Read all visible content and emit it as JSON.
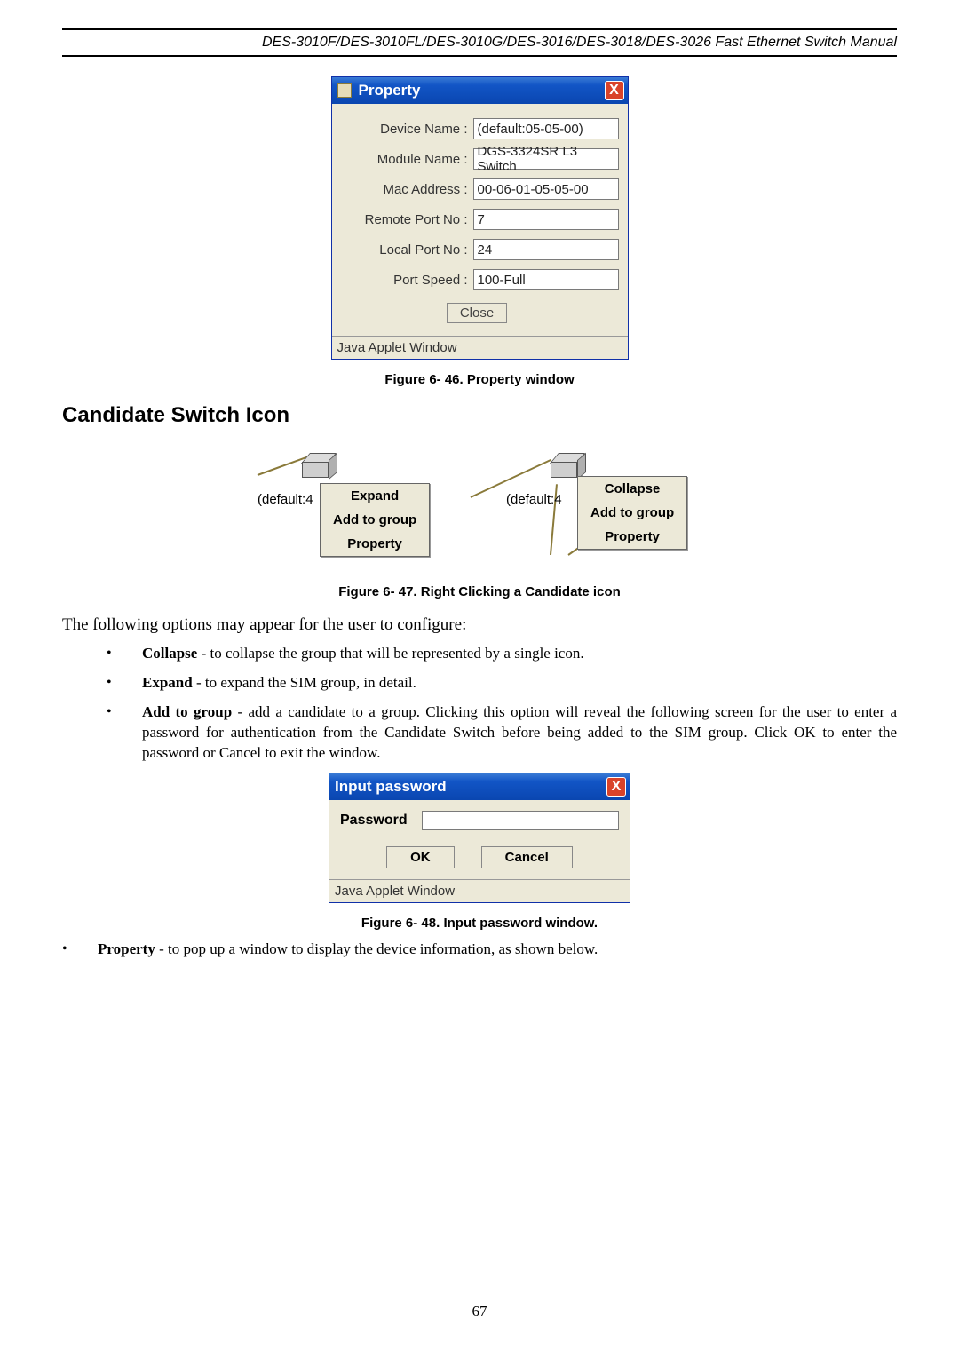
{
  "header": {
    "title": "DES-3010F/DES-3010FL/DES-3010G/DES-3016/DES-3018/DES-3026 Fast Ethernet Switch Manual"
  },
  "property_window": {
    "title": "Property",
    "close_x": "X",
    "rows": {
      "device_name_label": "Device Name :",
      "device_name_value": "(default:05-05-00)",
      "module_name_label": "Module Name :",
      "module_name_value": "DGS-3324SR L3 Switch",
      "mac_label": "Mac Address :",
      "mac_value": "00-06-01-05-05-00",
      "remote_port_label": "Remote Port No :",
      "remote_port_value": "7",
      "local_port_label": "Local Port No :",
      "local_port_value": "24",
      "port_speed_label": "Port Speed :",
      "port_speed_value": "100-Full"
    },
    "close_button": "Close",
    "status": "Java Applet Window"
  },
  "captions": {
    "fig46": "Figure 6- 46. Property window",
    "fig47": "Figure 6- 47. Right Clicking a Candidate icon",
    "fig48": "Figure 6- 48. Input password window."
  },
  "section_heading": "Candidate Switch Icon",
  "fig47": {
    "left": {
      "label": "(default:4",
      "menu": {
        "expand": "Expand",
        "add": "Add to group",
        "prop": "Property"
      }
    },
    "right": {
      "label": "(default:4",
      "menu": {
        "collapse": "Collapse",
        "add": "Add to group",
        "prop": "Property"
      }
    }
  },
  "paragraph_intro": "The following options may appear for the user to configure:",
  "list": {
    "collapse_b": "Collapse",
    "collapse_t": " - to collapse the group that will be represented by a single icon.",
    "expand_b": "Expand",
    "expand_t": " - to expand the SIM group, in detail.",
    "add_b": "Add to group",
    "add_t": " - add a candidate to a group. Clicking this option will reveal the following screen for the user to enter a password for authentication from the Candidate Switch before being added to the SIM group. Click OK to enter the password or Cancel to exit the window.",
    "property_b": "Property",
    "property_t": " - to pop up a window to display the device information, as shown below."
  },
  "password_window": {
    "title": "Input password",
    "close_x": "X",
    "label": "Password",
    "ok": "OK",
    "cancel": "Cancel",
    "status": "Java Applet Window"
  },
  "page_number": "67"
}
